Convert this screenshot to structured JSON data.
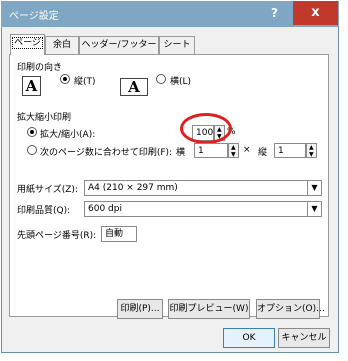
{
  "window": {
    "title": "ページ設定",
    "help_label": "?",
    "close_label": "x"
  },
  "tabs": [
    {
      "label": "ページ",
      "active": true
    },
    {
      "label": "余白",
      "active": false
    },
    {
      "label": "ヘッダー/フッター",
      "active": false
    },
    {
      "label": "シート",
      "active": false
    }
  ],
  "orientation": {
    "heading": "印刷の向き",
    "portrait_label": "縦(T)",
    "landscape_label": "横(L)",
    "portrait_icon": "A",
    "landscape_icon": "A",
    "selected": "portrait"
  },
  "scaling": {
    "heading": "拡大縮小印刷",
    "adjust_label": "拡大/縮小(A):",
    "adjust_value": "100",
    "percent_sign": "%",
    "fit_label": "次のページ数に合わせて印刷(F):",
    "wide_label": "横",
    "wide_value": "1",
    "times": "×",
    "tall_label": "縦",
    "tall_value": "1",
    "selected": "adjust"
  },
  "paper": {
    "size_label": "用紙サイズ(Z):",
    "size_value": "A4 (210 × 297 mm)",
    "quality_label": "印刷品質(Q):",
    "quality_value": "600 dpi",
    "first_page_label": "先頭ページ番号(R):",
    "first_page_value": "自動"
  },
  "buttons": {
    "print": "印刷(P)...",
    "preview": "印刷プレビュー(W)",
    "options": "オプション(O)...",
    "ok": "OK",
    "cancel": "キャンセル"
  },
  "annotation": {
    "highlight_color": "#e02020"
  }
}
